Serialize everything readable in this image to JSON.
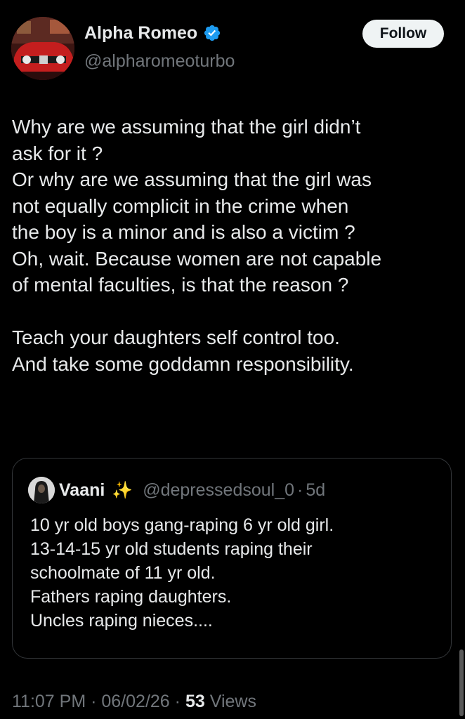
{
  "author": {
    "display_name": "Alpha Romeo",
    "handle": "@alpharomeoturbo",
    "verified_icon": "verified-badge-icon",
    "avatar_icon": "car-avatar"
  },
  "follow_button": {
    "label": "Follow"
  },
  "tweet": {
    "lines": [
      "Why are we assuming that the girl didn’t",
      "ask for it ?",
      "Or why are we assuming that the girl was",
      "not equally complicit in the crime when",
      "the boy is a minor and is also a victim ?",
      "Oh, wait. Because women are not capable",
      "of mental faculties, is that the reason ?",
      "",
      "Teach your daughters self control too.",
      "And take some goddamn responsibility."
    ]
  },
  "quote": {
    "display_name": "Vaani",
    "emoji": "✨",
    "handle": "@depressedsoul_0",
    "separator": "·",
    "time": "5d",
    "lines": [
      "10 yr old boys gang-raping 6 yr old girl.",
      "13-14-15 yr old students raping their",
      "schoolmate of 11 yr old.",
      "Fathers raping daughters.",
      "Uncles raping nieces...."
    ]
  },
  "meta": {
    "time": "11:07 PM",
    "separator": "·",
    "date": "06/02/26",
    "views_count": "53",
    "views_label": "Views"
  },
  "colors": {
    "background": "#000000",
    "text_primary": "#e7e9ea",
    "text_secondary": "#71767b",
    "verified": "#1d9bf0",
    "border": "#333639"
  }
}
